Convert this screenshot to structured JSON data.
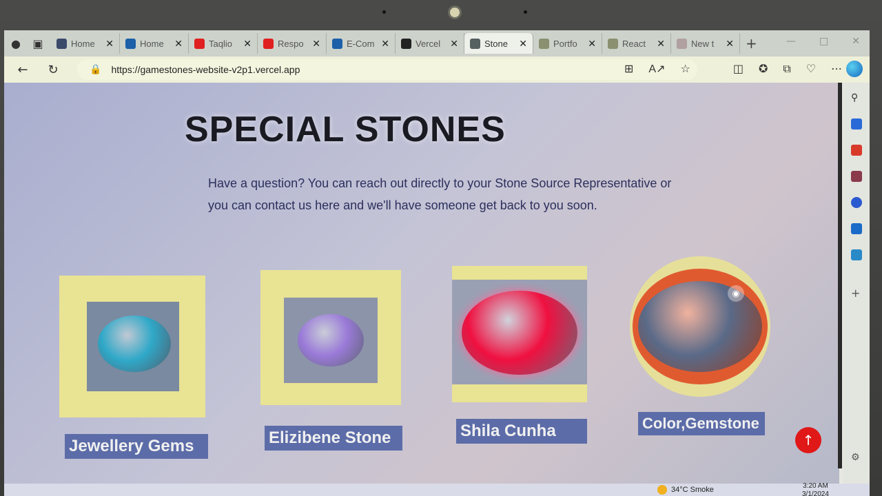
{
  "browser": {
    "tabs": [
      {
        "title": "Home",
        "fav": "#3b4a6a",
        "active": false
      },
      {
        "title": "Home",
        "fav": "#1d5fa8",
        "active": false
      },
      {
        "title": "Taqlio",
        "fav": "#e02020",
        "active": false
      },
      {
        "title": "Respo",
        "fav": "#e02020",
        "active": false
      },
      {
        "title": "E-Com",
        "fav": "#1d5fa8",
        "active": false
      },
      {
        "title": "Vercel",
        "fav": "#222222",
        "active": false
      },
      {
        "title": "Stone",
        "fav": "#556060",
        "active": true
      },
      {
        "title": "Portfo",
        "fav": "#8a9070",
        "active": false
      },
      {
        "title": "React",
        "fav": "#8a9070",
        "active": false
      },
      {
        "title": "New t",
        "fav": "#b0a0a0",
        "active": false
      }
    ],
    "url": "https://gamestones-website-v2p1.vercel.app",
    "icons": [
      "profile-icon",
      "tab-actions-icon",
      "back-icon",
      "refresh-icon",
      "lock-icon",
      "apps-icon",
      "read-aloud-icon",
      "favorite-star-icon",
      "split-screen-icon",
      "favorites-icon",
      "collections-icon",
      "browser-essentials-icon",
      "more-icon"
    ]
  },
  "page": {
    "title": "SPECIAL STONES",
    "description": "Have a question? You can reach out directly to your Stone Source Representative or you can contact us here and we'll have someone get back to you soon.",
    "cards": [
      {
        "label": "Jewellery Gems",
        "gem_color": "#2fa8c8"
      },
      {
        "label": "Elizibene Stone",
        "gem_color": "#9a7ad8"
      },
      {
        "label": "Shila Cunha",
        "gem_color": "#f01040"
      },
      {
        "label": "Color,Gemstone",
        "gem_color": "#5a6a88"
      }
    ],
    "scroll_top_icon": "arrow-up-icon"
  },
  "taskbar": {
    "weather": "34°C  Smoke",
    "time": "3:20 AM",
    "date": "3/1/2024"
  }
}
